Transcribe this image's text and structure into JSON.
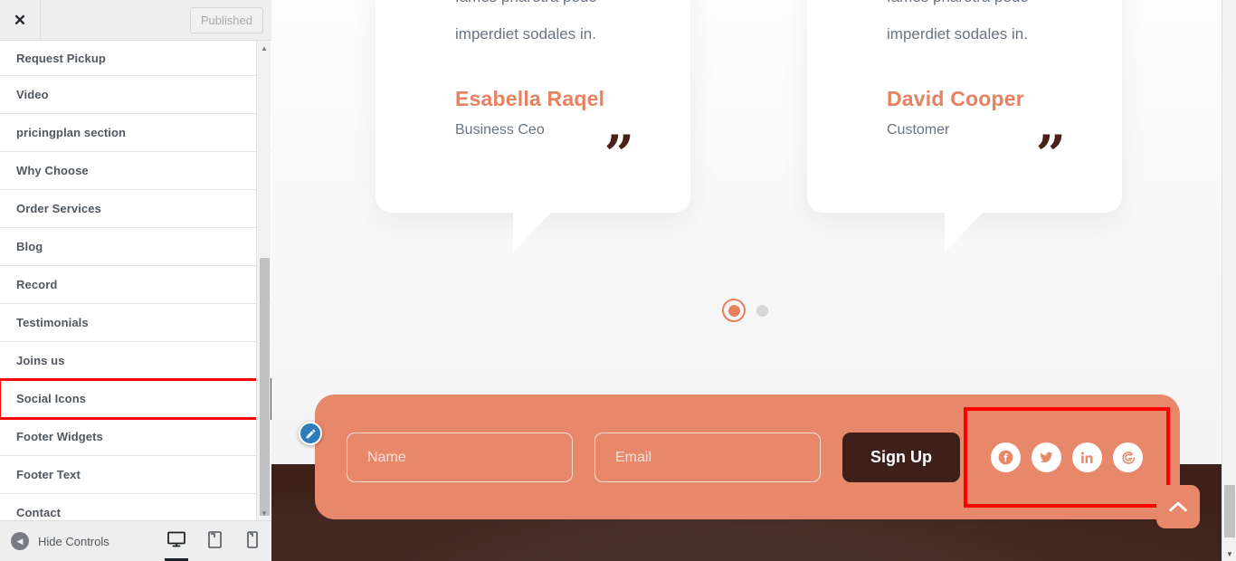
{
  "customizer": {
    "header": {
      "close_label": "✕",
      "publish_label": "Published"
    },
    "items": [
      {
        "label": "Request Pickup",
        "highlighted": false
      },
      {
        "label": "Video",
        "highlighted": false
      },
      {
        "label": "pricingplan section",
        "highlighted": false
      },
      {
        "label": "Why Choose",
        "highlighted": false
      },
      {
        "label": "Order Services",
        "highlighted": false
      },
      {
        "label": "Blog",
        "highlighted": false
      },
      {
        "label": "Record",
        "highlighted": false
      },
      {
        "label": "Testimonials",
        "highlighted": false
      },
      {
        "label": "Joins us",
        "highlighted": false
      },
      {
        "label": "Social Icons",
        "highlighted": true
      },
      {
        "label": "Footer Widgets",
        "highlighted": false
      },
      {
        "label": "Footer Text",
        "highlighted": false
      },
      {
        "label": "Contact",
        "highlighted": false
      }
    ],
    "footer": {
      "hide_controls_label": "Hide Controls",
      "devices": [
        {
          "name": "desktop",
          "active": true
        },
        {
          "name": "tablet",
          "active": false
        },
        {
          "name": "mobile",
          "active": false
        }
      ]
    }
  },
  "preview": {
    "testimonials": [
      {
        "text": "fames pharetra pede imperdiet sodales in.",
        "name": "Esabella Raqel",
        "role": "Business Ceo",
        "quote_mark": "”"
      },
      {
        "text": "fames pharetra pede imperdiet sodales in.",
        "name": "David Cooper",
        "role": "Customer",
        "quote_mark": "”"
      }
    ],
    "carousel": {
      "dots": [
        {
          "active": true
        },
        {
          "active": false
        }
      ]
    },
    "newsletter": {
      "name_placeholder": "Name",
      "email_placeholder": "Email",
      "name_value": "",
      "email_value": "",
      "signup_label": "Sign Up",
      "social_icons": [
        {
          "name": "facebook-icon"
        },
        {
          "name": "twitter-icon"
        },
        {
          "name": "linkedin-icon"
        },
        {
          "name": "google-icon"
        }
      ]
    },
    "back_to_top_label": "back-to-top"
  },
  "colors": {
    "accent_coral": "#e8886b",
    "name_coral": "#e8815f",
    "dark_brown": "#3c2019",
    "body_gray": "#6a7285",
    "highlight_red": "#ff0000",
    "edit_blue": "#2e7dba"
  }
}
